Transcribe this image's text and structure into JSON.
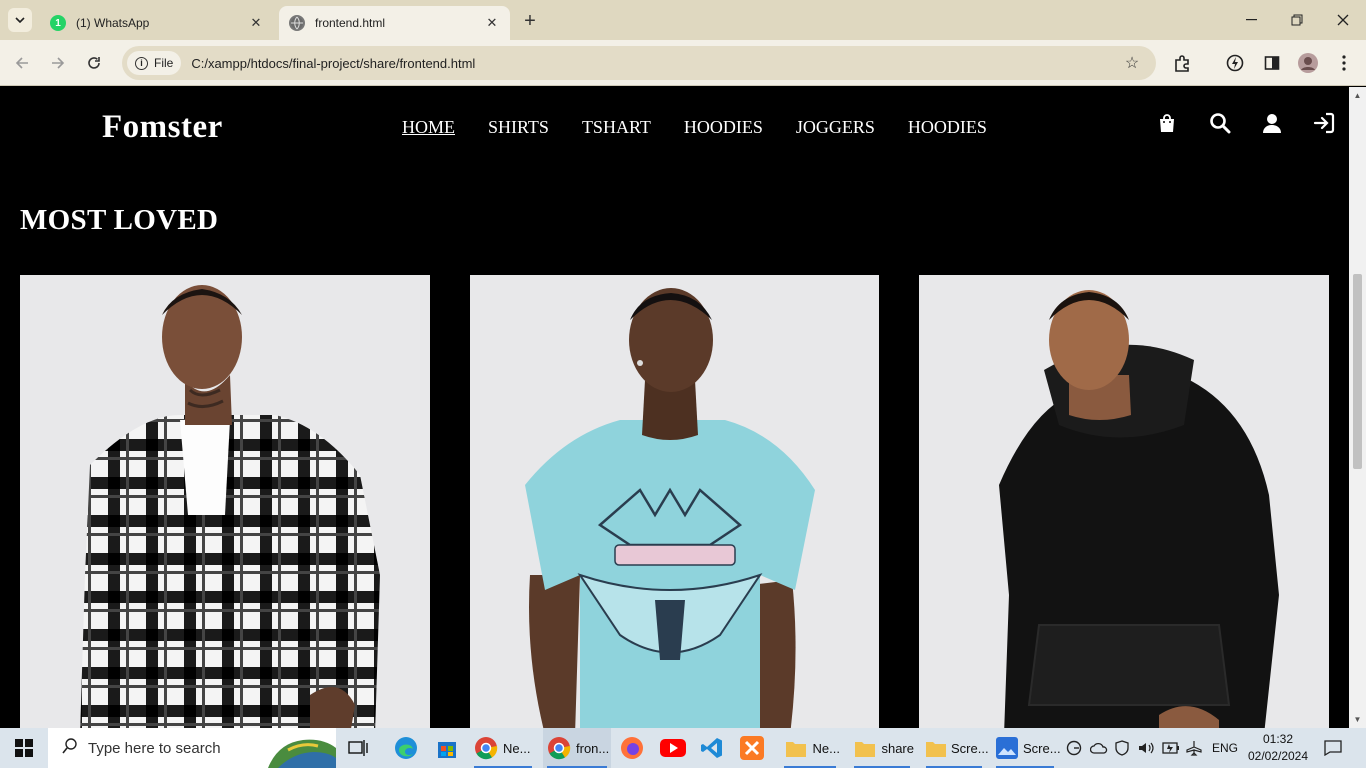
{
  "browser": {
    "tabs": [
      {
        "title": "(1) WhatsApp",
        "badge": "1",
        "active": false
      },
      {
        "title": "frontend.html",
        "active": true
      }
    ],
    "new_tab": "+",
    "chip_label": "File",
    "url": "C:/xampp/htdocs/final-project/share/frontend.html"
  },
  "site": {
    "logo": "Fomster",
    "nav": [
      "HOME",
      "SHIRTS",
      "TSHART",
      "HOODIES",
      "JOGGERS",
      "HOODIES"
    ],
    "header_icons": [
      "shopping-bag-icon",
      "search-icon",
      "user-icon",
      "login-icon"
    ],
    "section_title_light": "MOST ",
    "section_title_bold": "LOVED",
    "products": [
      {
        "image": "model in black and white plaid flannel overshirt"
      },
      {
        "image": "model in light blue graphic eagle t-shirt"
      },
      {
        "image": "model in black oversized hoodie"
      }
    ]
  },
  "taskbar": {
    "search_placeholder": "Type here to search",
    "apps": [
      {
        "label": "Ne..."
      },
      {
        "label": "fron..."
      },
      {
        "label": "Ne..."
      },
      {
        "label": "share"
      },
      {
        "label": "Scre..."
      },
      {
        "label": "Scre..."
      }
    ],
    "language": "ENG",
    "time": "01:32",
    "date": "02/02/2024"
  },
  "colors": {
    "page_bg": "#000000",
    "card_bg": "#e8e8ea",
    "tab_bar": "#dfd8c0",
    "toolbar": "#f3f0e7",
    "taskbar": "#dbe4ec"
  }
}
